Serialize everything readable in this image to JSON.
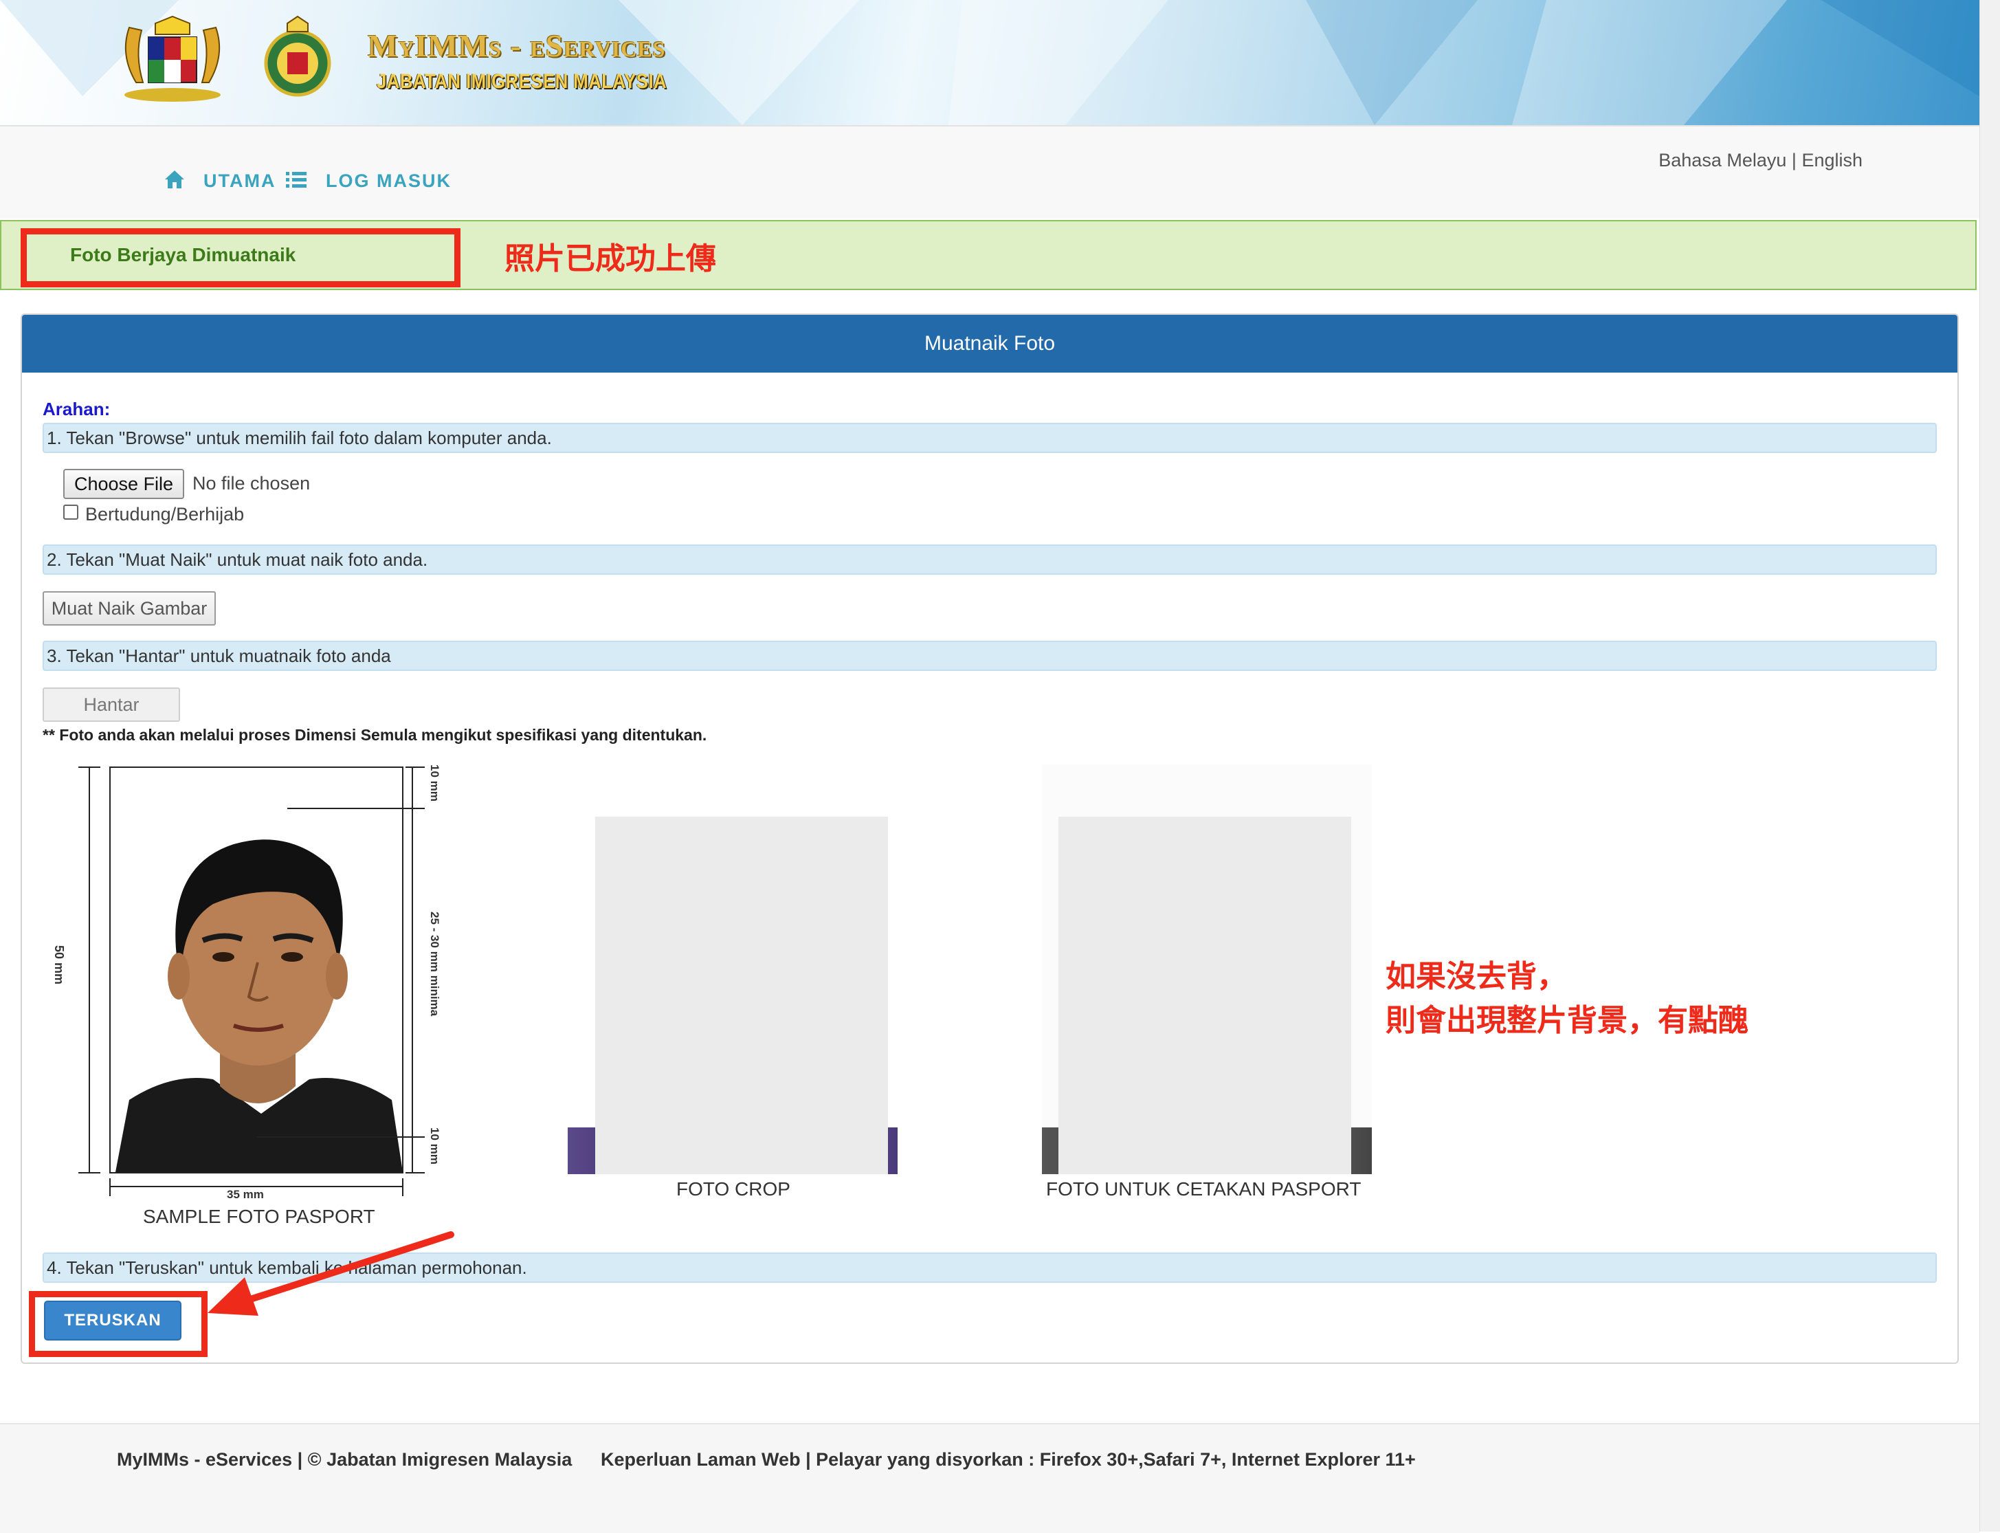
{
  "header": {
    "brand_title": "MyIMMs - eServices",
    "brand_subtitle": "JABATAN IMIGRESEN MALAYSIA",
    "emblem_left_icon": "malaysia-coat-of-arms",
    "emblem_right_icon": "immigration-department-crest"
  },
  "nav": {
    "home_icon": "home-icon",
    "home_label": "UTAMA",
    "login_icon": "list-icon",
    "login_label": "LOG MASUK",
    "lang_malay": "Bahasa Melayu",
    "lang_sep": "|",
    "lang_english": "English"
  },
  "alert": {
    "message": "Foto Berjaya Dimuatnaik",
    "annotation": "照片已成功上傳"
  },
  "panel": {
    "title": "Muatnaik Foto",
    "arahan_label": "Arahan:",
    "step1": "1. Tekan \"Browse\" untuk memilih fail foto dalam komputer anda.",
    "choose_file_label": "Choose File",
    "no_file_text": "No file chosen",
    "checkbox_label": "Bertudung/Berhijab",
    "checkbox_checked": false,
    "step2": "2. Tekan \"Muat Naik\" untuk muat naik foto anda.",
    "upload_button": "Muat Naik Gambar",
    "step3": "3. Tekan \"Hantar\" untuk muatnaik foto anda",
    "send_button": "Hantar",
    "note": "** Foto anda akan melalui proses Dimensi Semula mengikut spesifikasi yang ditentukan.",
    "step4": "4. Tekan \"Teruskan\" untuk kembali ke halaman permohonan.",
    "continue_button": "TERUSKAN"
  },
  "sample_photo": {
    "caption": "SAMPLE FOTO PASPORT",
    "dim_width": "35 mm",
    "dim_height": "50 mm",
    "dim_top": "10 mm",
    "dim_face": "25 - 30 mm minima",
    "dim_bottom": "10 mm"
  },
  "photos": {
    "crop_caption": "FOTO CROP",
    "print_caption": "FOTO UNTUK CETAKAN PASPORT"
  },
  "annotations": {
    "note_line1": "如果沒去背，",
    "note_line2": "則會出現整片背景，有點醜",
    "color": "#ee2b1a"
  },
  "footer": {
    "copyright": "MyIMMs - eServices | © Jabatan Imigresen Malaysia",
    "requirements": "Keperluan Laman Web | Pelayar yang disyorkan : Firefox 30+,Safari 7+, Internet Explorer 11+"
  },
  "colors": {
    "panel_header": "#226aa9",
    "nav_link": "#3aa3bd",
    "alert_bg": "#dff0c6",
    "alert_text": "#3d7a1a",
    "primary_button": "#3a86cc",
    "step_bg": "#d7ebf7"
  }
}
